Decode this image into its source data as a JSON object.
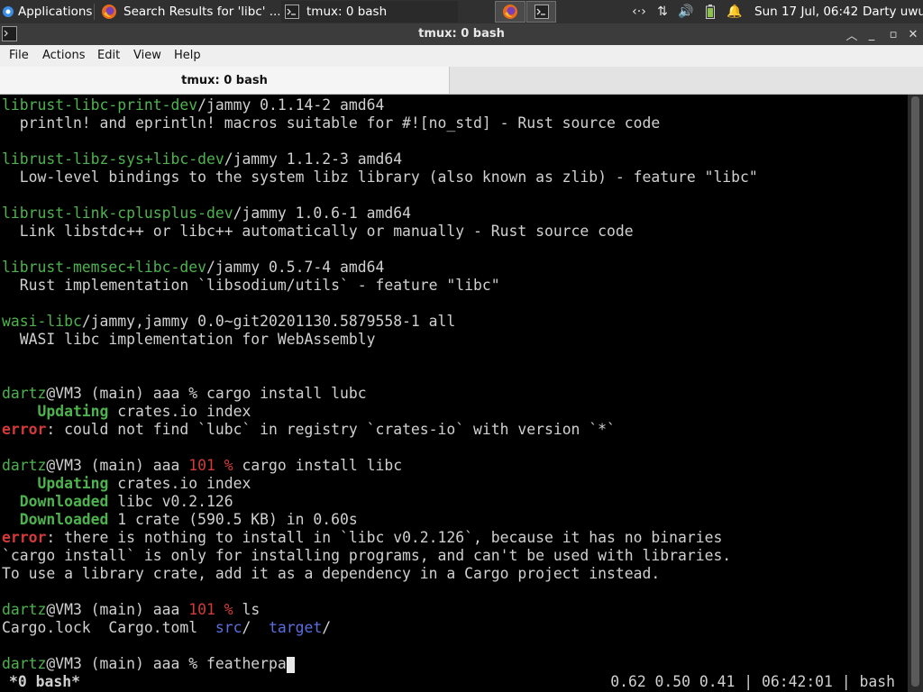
{
  "top_panel": {
    "applications_label": "Applications",
    "tasks": [
      {
        "label": "Search Results for 'libc' ...",
        "icon": "firefox-icon"
      },
      {
        "label": "tmux: 0 bash",
        "icon": "terminal-icon"
      }
    ],
    "clock": "Sun 17 Jul, 06:42",
    "user": "Darty uwu"
  },
  "window": {
    "title": "tmux: 0 bash",
    "menu": [
      "File",
      "Actions",
      "Edit",
      "View",
      "Help"
    ],
    "tab_label": "tmux: 0 bash"
  },
  "terminal": {
    "lines": [
      [
        {
          "t": "librust-libc-print-dev",
          "c": "green"
        },
        {
          "t": "/jammy 0.1.14-2 amd64"
        }
      ],
      [
        {
          "t": "  println! and eprintln! macros suitable for #![no_std] - Rust source code"
        }
      ],
      [],
      [
        {
          "t": "librust-libz-sys+libc-dev",
          "c": "green"
        },
        {
          "t": "/jammy 1.1.2-3 amd64"
        }
      ],
      [
        {
          "t": "  Low-level bindings to the system libz library (also known as zlib) - feature \"libc\""
        }
      ],
      [],
      [
        {
          "t": "librust-link-cplusplus-dev",
          "c": "green"
        },
        {
          "t": "/jammy 1.0.6-1 amd64"
        }
      ],
      [
        {
          "t": "  Link libstdc++ or libc++ automatically or manually - Rust source code"
        }
      ],
      [],
      [
        {
          "t": "librust-memsec+libc-dev",
          "c": "green"
        },
        {
          "t": "/jammy 0.5.7-4 amd64"
        }
      ],
      [
        {
          "t": "  Rust implementation `libsodium/utils` - feature \"libc\""
        }
      ],
      [],
      [
        {
          "t": "wasi-libc",
          "c": "green"
        },
        {
          "t": "/jammy,jammy 0.0~git20201130.5879558-1 all"
        }
      ],
      [
        {
          "t": "  WASI libc implementation for WebAssembly"
        }
      ],
      [],
      [],
      [
        {
          "t": "dartz",
          "c": "green"
        },
        {
          "t": "@VM3 (main) aaa % cargo install lubc"
        }
      ],
      [
        {
          "t": "    Updating",
          "c": "green bold"
        },
        {
          "t": " crates.io index"
        }
      ],
      [
        {
          "t": "error",
          "c": "red bold"
        },
        {
          "t": ": could not find `lubc` in registry `crates-io` with version `*`"
        }
      ],
      [],
      [
        {
          "t": "dartz",
          "c": "green"
        },
        {
          "t": "@VM3 (main) aaa "
        },
        {
          "t": "101 %",
          "c": "red"
        },
        {
          "t": " cargo install libc"
        }
      ],
      [
        {
          "t": "    Updating",
          "c": "green bold"
        },
        {
          "t": " crates.io index"
        }
      ],
      [
        {
          "t": "  Downloaded",
          "c": "green bold"
        },
        {
          "t": " libc v0.2.126"
        }
      ],
      [
        {
          "t": "  Downloaded",
          "c": "green bold"
        },
        {
          "t": " 1 crate (590.5 KB) in 0.60s"
        }
      ],
      [
        {
          "t": "error",
          "c": "red bold"
        },
        {
          "t": ": there is nothing to install in `libc v0.2.126`, because it has no binaries"
        }
      ],
      [
        {
          "t": "`cargo install` is only for installing programs, and can't be used with libraries."
        }
      ],
      [
        {
          "t": "To use a library crate, add it as a dependency in a Cargo project instead."
        }
      ],
      [],
      [
        {
          "t": "dartz",
          "c": "green"
        },
        {
          "t": "@VM3 (main) aaa "
        },
        {
          "t": "101 %",
          "c": "red"
        },
        {
          "t": " ls"
        }
      ],
      [
        {
          "t": "Cargo.lock  Cargo.toml  "
        },
        {
          "t": "src",
          "c": "blue"
        },
        {
          "t": "/  "
        },
        {
          "t": "target",
          "c": "blue"
        },
        {
          "t": "/"
        }
      ],
      [],
      [
        {
          "t": "dartz",
          "c": "green"
        },
        {
          "t": "@VM3 (main) aaa % featherpa"
        },
        {
          "cursor": true
        }
      ]
    ],
    "status_left": "*0 bash*",
    "status_right": "0.62 0.50 0.41 | 06:42:01 | bash"
  },
  "colors": {
    "green": "#4eb34e",
    "red": "#d43a3a",
    "blue": "#5a6ee0"
  }
}
